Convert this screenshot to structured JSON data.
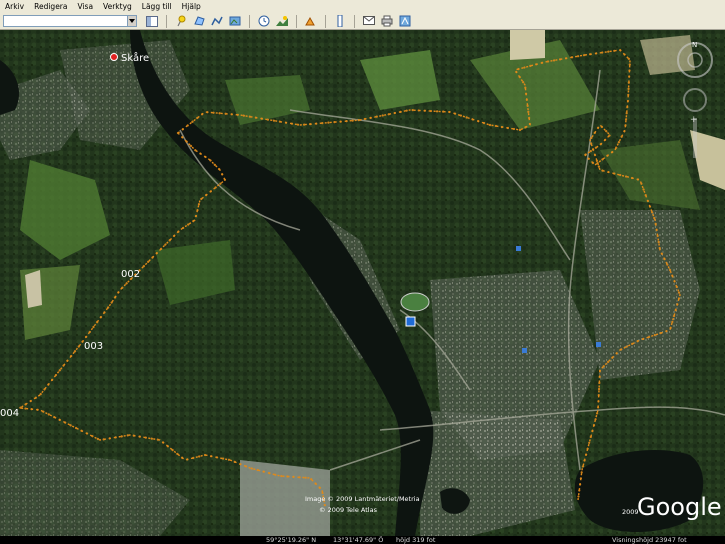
{
  "menu": {
    "items": [
      {
        "label": "Arkiv"
      },
      {
        "label": "Redigera"
      },
      {
        "label": "Visa"
      },
      {
        "label": "Verktyg"
      },
      {
        "label": "Lägg till"
      },
      {
        "label": "Hjälp"
      }
    ]
  },
  "toolbar": {
    "search_value": "",
    "buttons": [
      {
        "icon": "sidebar-toggle-icon"
      },
      {
        "icon": "placemark-icon"
      },
      {
        "icon": "polygon-icon"
      },
      {
        "icon": "path-icon"
      },
      {
        "icon": "image-overlay-icon"
      },
      {
        "icon": "historical-imagery-icon"
      },
      {
        "icon": "sunlight-icon"
      },
      {
        "icon": "sky-icon"
      },
      {
        "icon": "ruler-icon"
      },
      {
        "icon": "email-icon"
      },
      {
        "icon": "print-icon"
      },
      {
        "icon": "maps-icon"
      }
    ]
  },
  "map": {
    "place_label": "Skåre",
    "waypoints": [
      "002",
      "003",
      "004"
    ],
    "copyright_1": "Image © 2009 Lantmäteriet/Metria",
    "copyright_2": "© 2009 Tele Atlas",
    "logo": "Google",
    "logo_year": "2009",
    "track_color": "#e08a1a"
  },
  "status": {
    "latitude": "59°25'19.26\" N",
    "longitude": "13°31'47.69\" Ö",
    "elevation": "höjd  319 fot",
    "eye_altitude": "Visningshöjd   23947 fot"
  }
}
